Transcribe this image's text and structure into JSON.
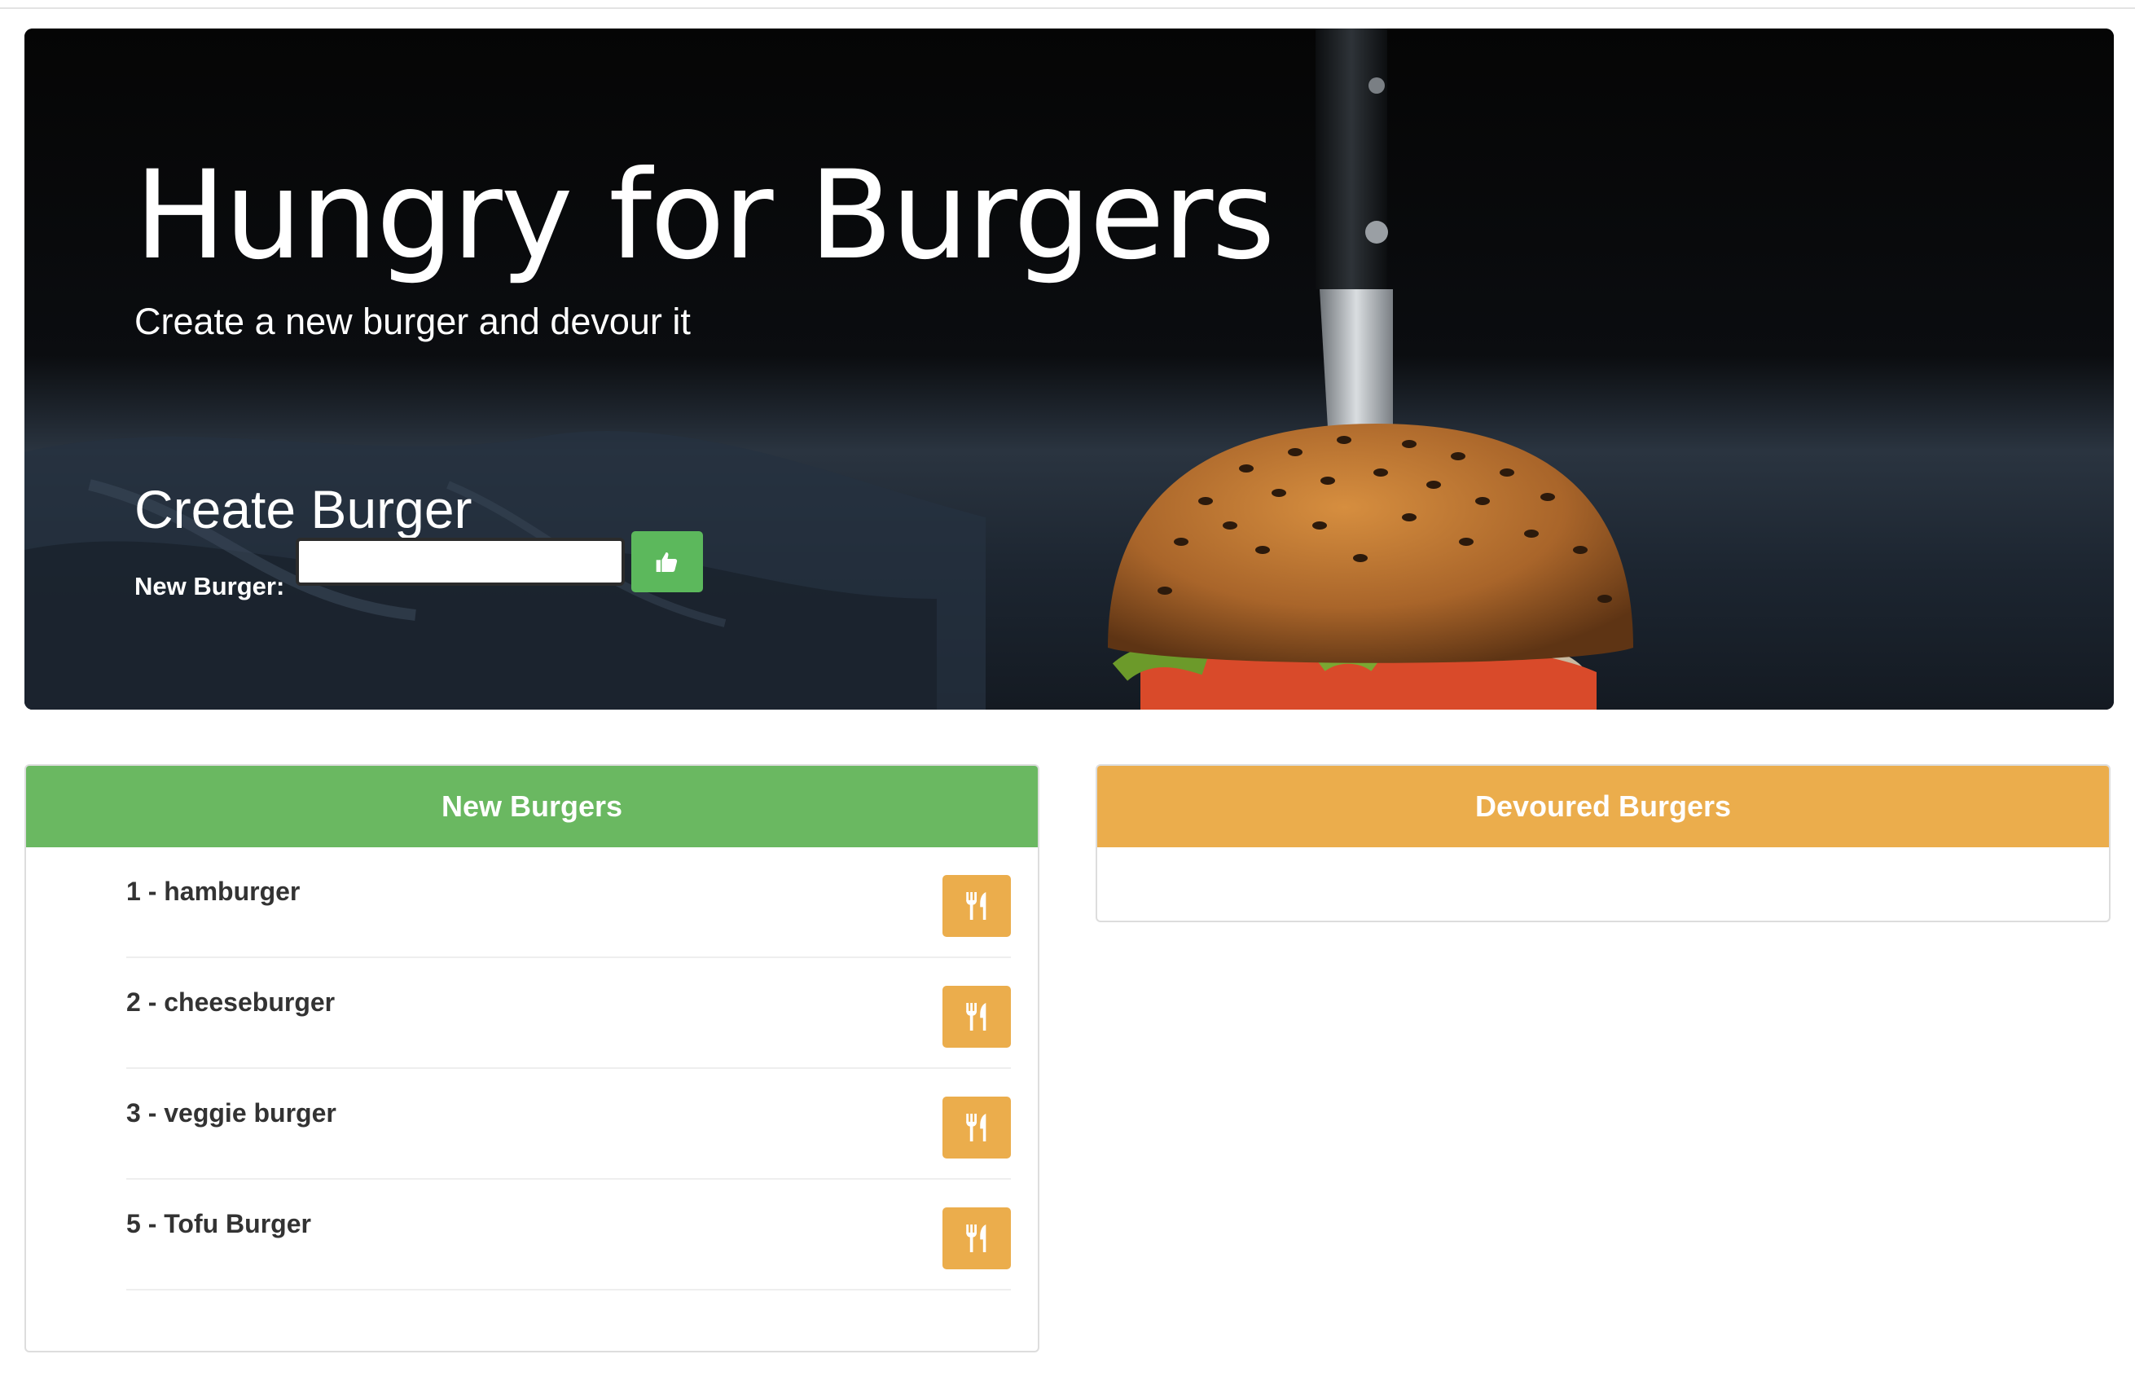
{
  "hero": {
    "title": "Hungry for Burgers",
    "subtitle": "Create a new burger and devour it"
  },
  "create_form": {
    "heading": "Create Burger",
    "label": "New Burger:",
    "input_value": "",
    "submit_icon": "thumbs-up-icon"
  },
  "new_burgers": {
    "title": "New Burgers",
    "header_color": "#6ab861",
    "items": [
      {
        "label": "1 - hamburger",
        "action_icon": "utensils-icon"
      },
      {
        "label": "2 - cheeseburger",
        "action_icon": "utensils-icon"
      },
      {
        "label": "3 - veggie burger",
        "action_icon": "utensils-icon"
      },
      {
        "label": "5 - Tofu Burger",
        "action_icon": "utensils-icon"
      }
    ]
  },
  "devoured_burgers": {
    "title": "Devoured Burgers",
    "header_color": "#ebad4c",
    "items": []
  },
  "colors": {
    "success": "#5cb85c",
    "warning": "#ebad4c"
  }
}
